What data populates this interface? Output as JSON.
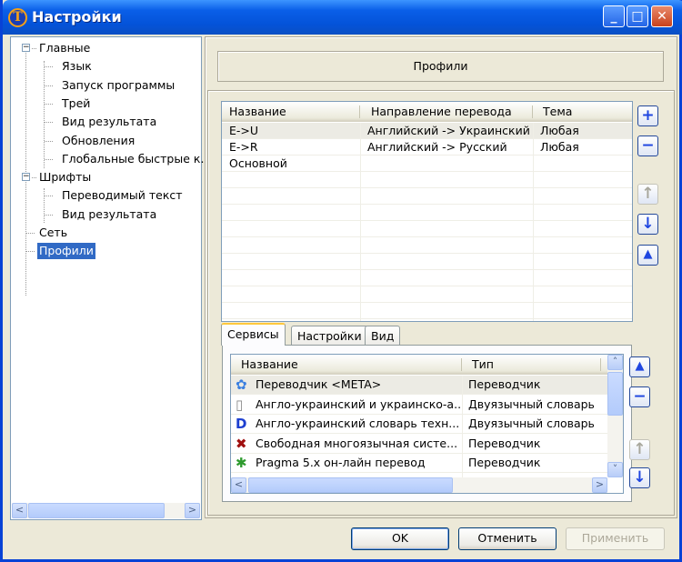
{
  "window": {
    "title": "Настройки",
    "logo_letter": "T",
    "minimize": "_",
    "maximize": "□",
    "close": "✕"
  },
  "tree": [
    {
      "label": "Главные",
      "level": 0,
      "expanded": true
    },
    {
      "label": "Язык",
      "level": 1
    },
    {
      "label": "Запуск программы",
      "level": 1
    },
    {
      "label": "Трей",
      "level": 1
    },
    {
      "label": "Вид результата",
      "level": 1
    },
    {
      "label": "Обновления",
      "level": 1
    },
    {
      "label": "Глобальные быстрые к.",
      "level": 1
    },
    {
      "label": "Шрифты",
      "level": 0,
      "expanded": true
    },
    {
      "label": "Переводимый текст",
      "level": 1
    },
    {
      "label": "Вид результата",
      "level": 1
    },
    {
      "label": "Сеть",
      "level": 0
    },
    {
      "label": "Профили",
      "level": 0,
      "selected": true
    }
  ],
  "page_title": "Профили",
  "profiles": {
    "columns": [
      "Название",
      "Направление перевода",
      "Тема"
    ],
    "rows": [
      [
        "E->U",
        "Английский -> Украинский",
        "Любая"
      ],
      [
        "E->R",
        "Английский -> Русский",
        "Любая"
      ],
      [
        "Основной",
        "",
        ""
      ]
    ]
  },
  "profile_buttons": {
    "add": "+",
    "remove": "−",
    "up": "↑",
    "down": "↓",
    "collapse": "▲"
  },
  "tabs": [
    "Сервисы",
    "Настройки",
    "Вид"
  ],
  "services": {
    "columns": [
      "Название",
      "Тип"
    ],
    "rows": [
      {
        "name": "Переводчик <META>",
        "type": "Переводчик",
        "icon": "flower-icon"
      },
      {
        "name": "Англо-украинский и украинско-а...",
        "type": "Двуязычный словарь",
        "icon": "document-icon"
      },
      {
        "name": "Англо-украинский словарь техн...",
        "type": "Двуязычный словарь",
        "icon": "dl-icon"
      },
      {
        "name": "Свободная многоязычная систе...",
        "type": "Переводчик",
        "icon": "cross-icon"
      },
      {
        "name": "Pragma 5.x он-лайн перевод",
        "type": "Переводчик",
        "icon": "puzzle-icon"
      }
    ]
  },
  "dialog_buttons": {
    "ok": "OK",
    "cancel": "Отменить",
    "apply": "Применить"
  }
}
